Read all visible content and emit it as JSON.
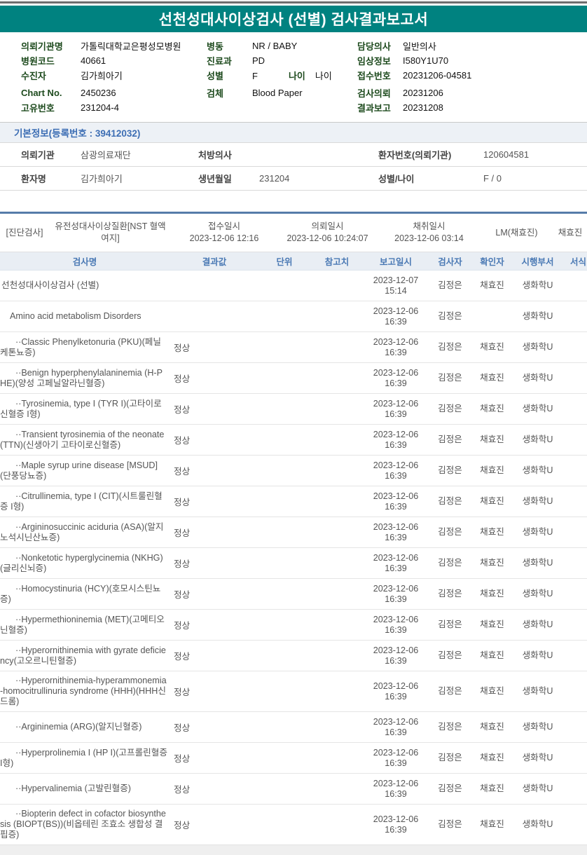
{
  "page": {
    "title": "선천성대사이상검사 (선별) 검사결과보고서"
  },
  "colors": {
    "banner_teal": "#008280",
    "label_green": "#1d4a1d",
    "section_title_blue": "#3d6eb4",
    "table_header_blue": "#4a79b4",
    "table_header_bg": "#e9eef4",
    "diag_top_border": "#567ca9"
  },
  "patient_info": {
    "rows": [
      [
        {
          "label": "의뢰기관명",
          "value": "가톨릭대학교은평성모병원"
        },
        {
          "label": "병동",
          "value": "NR / BABY"
        },
        {
          "label": "담당의사",
          "value": "일반의사"
        }
      ],
      [
        {
          "label": "병원코드",
          "value": "40661"
        },
        {
          "label": "진료과",
          "value": "PD"
        },
        {
          "label": "임상정보",
          "value": "I580Y1U70"
        }
      ],
      [
        {
          "label": "수진자",
          "value": "김가희아기"
        },
        {
          "label": "성별",
          "value": "F",
          "label2": "나이",
          "value2": "나이"
        },
        {
          "label": "접수번호",
          "value": "20231206-04581"
        }
      ],
      [
        {
          "label": "Chart No.",
          "value": "2450236"
        },
        {
          "label": "검체",
          "value": "Blood Paper"
        },
        {
          "label": "검사의뢰",
          "value": "20231206"
        }
      ],
      [
        {
          "label": "고유번호",
          "value": "231204-4"
        },
        null,
        {
          "label": "결과보고",
          "value": "20231208"
        }
      ]
    ]
  },
  "basic_info": {
    "title": "기본정보(등록번호 : 39412032)",
    "rows": [
      [
        {
          "label": "의뢰기관",
          "value": "삼광의료재단"
        },
        {
          "label": "처방의사",
          "value": ""
        },
        {
          "label": "환자번호(의뢰기관)",
          "value": "120604581"
        }
      ],
      [
        {
          "label": "환자명",
          "value": "김가희아기"
        },
        {
          "label": "생년월일",
          "value": "231204"
        },
        {
          "label": "성별/나이",
          "value": "F / 0"
        }
      ]
    ]
  },
  "diagnosis": {
    "tag": "[진단검사]",
    "test_group": "유전성대사이상질환[NST 혈액여지]",
    "columns": [
      {
        "label": "접수일시",
        "value": "2023-12-06 12:16"
      },
      {
        "label": "의뢰일시",
        "value": "2023-12-06 10:24:07"
      },
      {
        "label": "채취일시",
        "value": "2023-12-06 03:14"
      }
    ],
    "collector": "LM(채효진)",
    "collector2": "채효진"
  },
  "table": {
    "headers": [
      "검사명",
      "결과값",
      "단위",
      "참고치",
      "보고일시",
      "검사자",
      "확인자",
      "시행부서",
      "서식"
    ],
    "rows": [
      {
        "name": "선천성대사이상검사 (선별)",
        "indent": 0,
        "result": "",
        "date": "2023-12-07",
        "time": "15:14",
        "tester": "김정은",
        "checker": "채효진",
        "dept": "생화학U"
      },
      {
        "name": "Amino acid metabolism Disorders",
        "indent": 1,
        "result": "",
        "date": "2023-12-06",
        "time": "16:39",
        "tester": "김정은",
        "checker": "",
        "dept": "생화학U"
      },
      {
        "name": "··Classic Phenylketonuria (PKU)(페닐케톤뇨증)",
        "indent": 2,
        "result": "정상",
        "date": "2023-12-06",
        "time": "16:39",
        "tester": "김정은",
        "checker": "채효진",
        "dept": "생화학U"
      },
      {
        "name": "··Benign hyperphenylalaninemia (H-PHE)(양성 고페닐알라닌혈증)",
        "indent": 2,
        "result": "정상",
        "date": "2023-12-06",
        "time": "16:39",
        "tester": "김정은",
        "checker": "채효진",
        "dept": "생화학U"
      },
      {
        "name": "··Tyrosinemia, type I (TYR I)(고타이로신혈증 I형)",
        "indent": 2,
        "result": "정상",
        "date": "2023-12-06",
        "time": "16:39",
        "tester": "김정은",
        "checker": "채효진",
        "dept": "생화학U"
      },
      {
        "name": "··Transient tyrosinemia of the neonate (TTN)(신생아기 고타이로신혈증)",
        "indent": 2,
        "result": "정상",
        "date": "2023-12-06",
        "time": "16:39",
        "tester": "김정은",
        "checker": "채효진",
        "dept": "생화학U"
      },
      {
        "name": "··Maple syrup urine disease [MSUD](단풍당뇨증)",
        "indent": 2,
        "result": "정상",
        "date": "2023-12-06",
        "time": "16:39",
        "tester": "김정은",
        "checker": "채효진",
        "dept": "생화학U"
      },
      {
        "name": "··Citrullinemia, type I (CIT)(시트룰린혈증 I형)",
        "indent": 2,
        "result": "정상",
        "date": "2023-12-06",
        "time": "16:39",
        "tester": "김정은",
        "checker": "채효진",
        "dept": "생화학U"
      },
      {
        "name": "··Argininosuccinic aciduria (ASA)(알지노석시닌산뇨증)",
        "indent": 2,
        "result": "정상",
        "date": "2023-12-06",
        "time": "16:39",
        "tester": "김정은",
        "checker": "채효진",
        "dept": "생화학U"
      },
      {
        "name": "··Nonketotic hyperglycinemia (NKHG)(글리신뇌증)",
        "indent": 2,
        "result": "정상",
        "date": "2023-12-06",
        "time": "16:39",
        "tester": "김정은",
        "checker": "채효진",
        "dept": "생화학U"
      },
      {
        "name": "··Homocystinuria (HCY)(호모시스틴뇨증)",
        "indent": 2,
        "result": "정상",
        "date": "2023-12-06",
        "time": "16:39",
        "tester": "김정은",
        "checker": "채효진",
        "dept": "생화학U"
      },
      {
        "name": "··Hypermethioninemia (MET)(고메티오닌혈증)",
        "indent": 2,
        "result": "정상",
        "date": "2023-12-06",
        "time": "16:39",
        "tester": "김정은",
        "checker": "채효진",
        "dept": "생화학U"
      },
      {
        "name": "··Hyperornithinemia with gyrate deficiency(고오르니틴혈증)",
        "indent": 2,
        "result": "정상",
        "date": "2023-12-06",
        "time": "16:39",
        "tester": "김정은",
        "checker": "채효진",
        "dept": "생화학U"
      },
      {
        "name": "··Hyperornithinemia-hyperammonemia-homocitrullinuria syndrome (HHH)(HHH신드롬)",
        "indent": 2,
        "result": "정상",
        "date": "2023-12-06",
        "time": "16:39",
        "tester": "김정은",
        "checker": "채효진",
        "dept": "생화학U"
      },
      {
        "name": "··Argininemia (ARG)(알지닌혈증)",
        "indent": 2,
        "result": "정상",
        "date": "2023-12-06",
        "time": "16:39",
        "tester": "김정은",
        "checker": "채효진",
        "dept": "생화학U"
      },
      {
        "name": "··Hyperprolinemia I (HP I)(고프롤린혈증 I형)",
        "indent": 2,
        "result": "정상",
        "date": "2023-12-06",
        "time": "16:39",
        "tester": "김정은",
        "checker": "채효진",
        "dept": "생화학U"
      },
      {
        "name": "··Hypervalinemia (고발린혈증)",
        "indent": 2,
        "result": "정상",
        "date": "2023-12-06",
        "time": "16:39",
        "tester": "김정은",
        "checker": "채효진",
        "dept": "생화학U"
      },
      {
        "name": "··Biopterin defect in cofactor biosynthesis (BIOPT(BS))(비옵테린 조효소 생합성 결핍증)",
        "indent": 2,
        "result": "정상",
        "date": "2023-12-06",
        "time": "16:39",
        "tester": "김정은",
        "checker": "채효진",
        "dept": "생화학U"
      }
    ]
  }
}
